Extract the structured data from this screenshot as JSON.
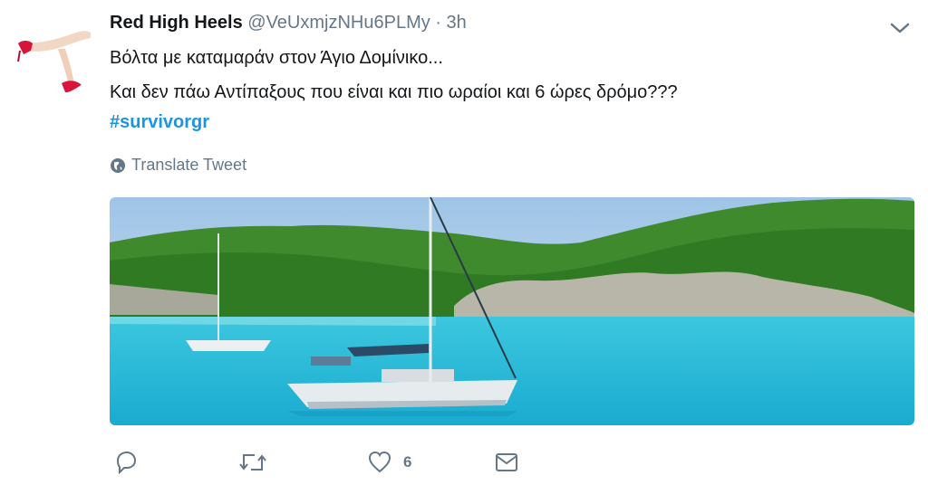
{
  "tweet": {
    "display_name": "Red High Heels",
    "handle": "@VeUxmjzNHu6PLMy",
    "separator": "·",
    "time": "3h",
    "text_line_1": "Βόλτα με καταμαράν στον Άγιο Δομίνικο...",
    "text_line_2": "Και δεν πάω Αντίπαξους που είναι και πιο ωραίοι και 6 ώρες δρόμο???",
    "hashtag": "#survivorgr",
    "translate_label": "Translate Tweet"
  },
  "actions": {
    "reply_count": "",
    "retweet_count": "",
    "like_count": "6"
  },
  "colors": {
    "link_blue": "#1b95e0",
    "muted_gray": "#657786",
    "sea": "#17b4d6",
    "heel_red": "#d8143a"
  },
  "icons": [
    "globe-icon",
    "chevron-down-icon",
    "reply-icon",
    "retweet-icon",
    "heart-icon",
    "dm-envelope-icon"
  ]
}
